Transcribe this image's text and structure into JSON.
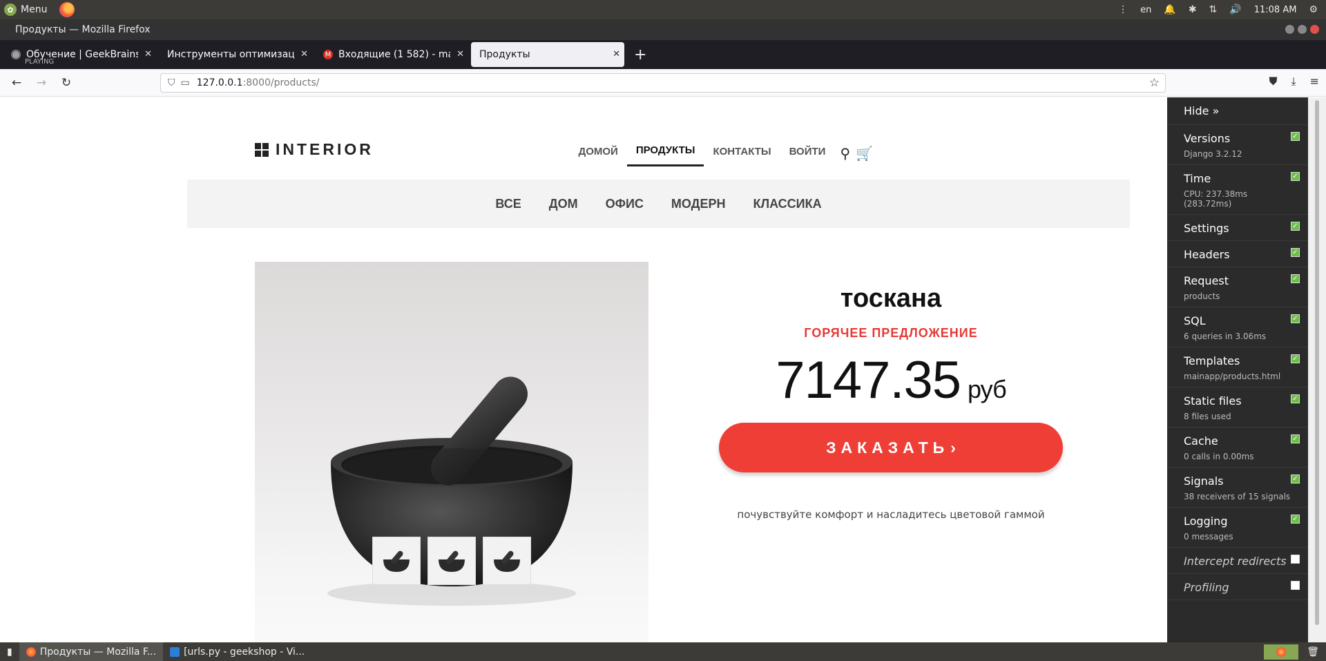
{
  "os": {
    "menu_label": "Menu",
    "lang": "en",
    "clock": "11:08 AM"
  },
  "window": {
    "title": "Продукты — Mozilla Firefox"
  },
  "tabs": [
    {
      "label": "Обучение | GeekBrains - ",
      "sub": "PLAYING",
      "icon": "geekbrains-icon"
    },
    {
      "label": "Инструменты оптимизации",
      "icon": ""
    },
    {
      "label": "Входящие (1 582) - maxe",
      "icon": "gmail-icon"
    },
    {
      "label": "Продукты",
      "icon": "",
      "active": true
    }
  ],
  "address": {
    "host": "127.0.0.1",
    "path": ":8000/products/"
  },
  "site": {
    "logo": "INTERIOR",
    "nav": [
      {
        "label": "ДОМОЙ"
      },
      {
        "label": "ПРОДУКТЫ",
        "active": true
      },
      {
        "label": "КОНТАКТЫ"
      },
      {
        "label": "ВОЙТИ"
      }
    ],
    "categories": [
      "ВСЕ",
      "ДОМ",
      "ОФИС",
      "МОДЕРН",
      "КЛАССИКА"
    ]
  },
  "product": {
    "title": "тоскана",
    "hot_label": "ГОРЯЧЕЕ ПРЕДЛОЖЕНИЕ",
    "price": "7147.35",
    "currency": "руб",
    "order_label": "ЗАКАЗАТЬ",
    "description": "почувствуйте комфорт и насладитесь цветовой гаммой"
  },
  "debug_toolbar": {
    "hide_label": "Hide »",
    "panels": [
      {
        "name": "Versions",
        "sub": "Django 3.2.12",
        "checked": true
      },
      {
        "name": "Time",
        "sub": "CPU: 237.38ms (283.72ms)",
        "checked": true
      },
      {
        "name": "Settings",
        "sub": "",
        "checked": true
      },
      {
        "name": "Headers",
        "sub": "",
        "checked": true
      },
      {
        "name": "Request",
        "sub": "products",
        "checked": true
      },
      {
        "name": "SQL",
        "sub": "6 queries in 3.06ms",
        "checked": true
      },
      {
        "name": "Templates",
        "sub": "mainapp/products.html",
        "checked": true
      },
      {
        "name": "Static files",
        "sub": "8 files used",
        "checked": true
      },
      {
        "name": "Cache",
        "sub": "0 calls in 0.00ms",
        "checked": true
      },
      {
        "name": "Signals",
        "sub": "38 receivers of 15 signals",
        "checked": true
      },
      {
        "name": "Logging",
        "sub": "0 messages",
        "checked": true
      },
      {
        "name": "Intercept redirects",
        "sub": "",
        "checked": false
      },
      {
        "name": "Profiling",
        "sub": "",
        "checked": false
      }
    ]
  },
  "taskbar": {
    "items": [
      "Продукты — Mozilla F...",
      "[urls.py - geekshop - Vi..."
    ]
  },
  "colors": {
    "accent": "#ef3e36",
    "hot": "#e53935",
    "toolbar_bg": "#2b2b2b"
  }
}
